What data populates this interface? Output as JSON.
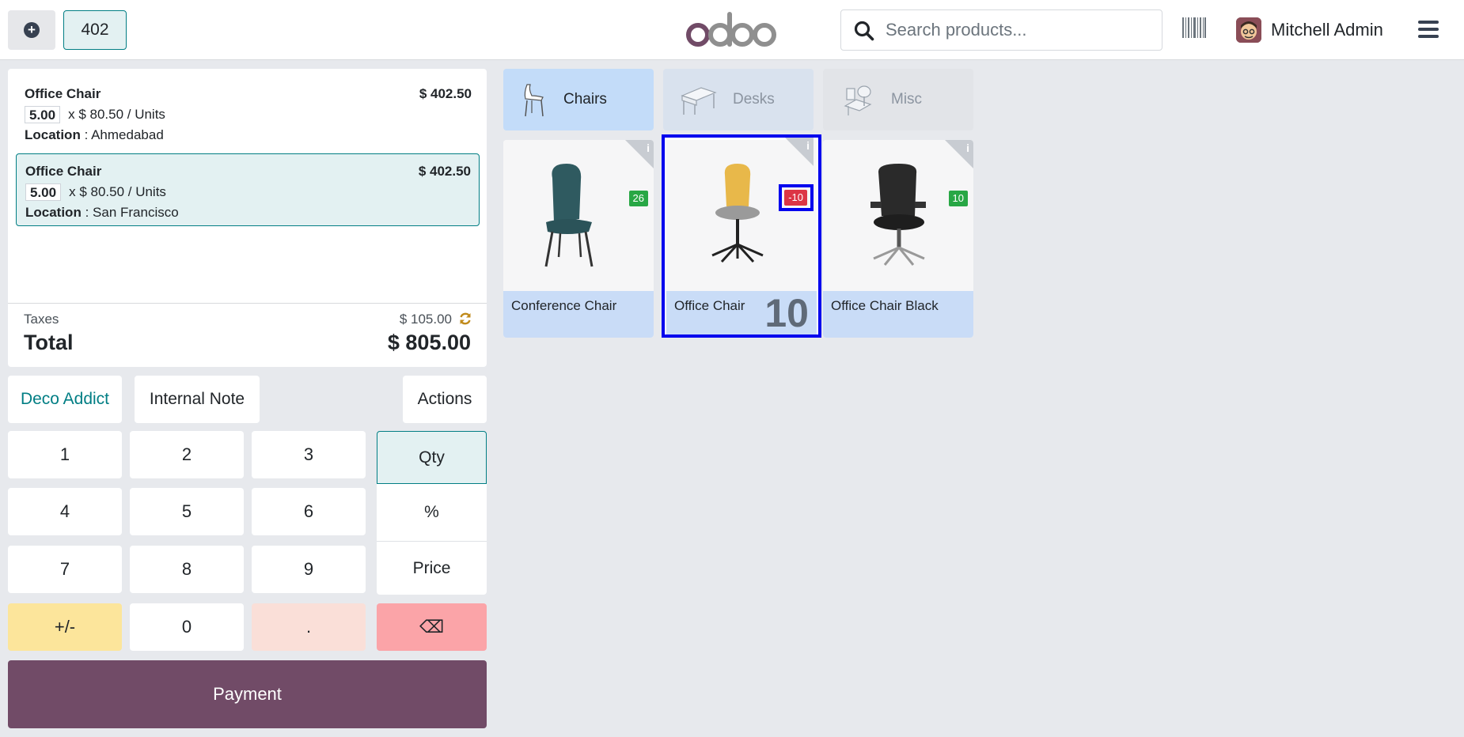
{
  "header": {
    "order_number": "402",
    "search_placeholder": "Search products...",
    "user_name": "Mitchell Admin"
  },
  "order": {
    "lines": [
      {
        "product": "Office Chair",
        "price": "$ 402.50",
        "qty": "5.00",
        "unit_price": "x $ 80.50 / Units",
        "location_label": "Location",
        "location": ": Ahmedabad",
        "selected": false
      },
      {
        "product": "Office Chair",
        "price": "$ 402.50",
        "qty": "5.00",
        "unit_price": "x $ 80.50 / Units",
        "location_label": "Location",
        "location": ": San Francisco",
        "selected": true
      }
    ],
    "taxes_label": "Taxes",
    "taxes_value": "$ 105.00",
    "total_label": "Total",
    "total_value": "$ 805.00"
  },
  "controls": {
    "customer": "Deco Addict",
    "internal_note": "Internal Note",
    "actions": "Actions"
  },
  "numpad": {
    "keys": [
      "1",
      "2",
      "3",
      "4",
      "5",
      "6",
      "7",
      "8",
      "9",
      "+/-",
      "0",
      "."
    ],
    "modes": [
      "Qty",
      "%",
      "Price"
    ],
    "active_mode": "Qty",
    "backspace": "⌫",
    "payment": "Payment"
  },
  "categories": [
    {
      "name": "Chairs",
      "active": true
    },
    {
      "name": "Desks",
      "active": false
    },
    {
      "name": "Misc",
      "active": false
    }
  ],
  "products": [
    {
      "name": "Conference Chair",
      "stock": "26",
      "stock_status": "green"
    },
    {
      "name": "Office Chair",
      "stock": "-10",
      "stock_status": "red",
      "cart_qty": "10"
    },
    {
      "name": "Office Chair Black",
      "stock": "10",
      "stock_status": "green"
    }
  ],
  "colors": {
    "brand": "#714b67",
    "accent": "#017e84",
    "highlight": "#0000ee"
  }
}
